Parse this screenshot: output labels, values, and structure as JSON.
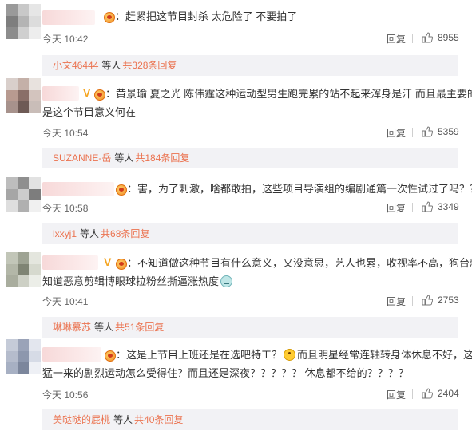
{
  "comments": [
    {
      "lines": [
        "：赶紧把这节目封杀 太危险了 不要拍了"
      ],
      "time": "今天 10:42",
      "reply": "回复",
      "likes": "8955",
      "replies": {
        "who": "小文46444",
        "mid": "等人",
        "count": "共328条回复"
      },
      "avatar_colors": [
        "#9a9a9a",
        "#c8c8c8",
        "#e6e6e6",
        "#7e7e7e",
        "#b4b4b4",
        "#dcdcdc",
        "#8c8c8c",
        "#cfcfcf",
        "#ededed"
      ]
    },
    {
      "lines": [
        "：黄景瑜 夏之光 陈伟霆这种运动型男生跑完累的站不起来浑身是汗 而且最主要的",
        "是这个节目意义何在"
      ],
      "time": "今天 10:54",
      "reply": "回复",
      "likes": "5359",
      "replies": {
        "who": "SUZANNE-岳",
        "mid": "等人",
        "count": "共184条回复"
      },
      "avatar_colors": [
        "#d9cfcb",
        "#c4b0a8",
        "#e8e2de",
        "#b89a90",
        "#8a6f68",
        "#d3c4be",
        "#a7928c",
        "#6e5a55",
        "#c9bdb8"
      ]
    },
    {
      "lines": [
        "：害，为了刺激，啥都敢拍，这些项目导演组的编剧通篇一次性试过了吗？？"
      ],
      "time": "今天 10:58",
      "reply": "回复",
      "likes": "3349",
      "replies": {
        "who": "lxxyj1",
        "mid": "等人",
        "count": "共68条回复"
      },
      "avatar_colors": [
        "#bdbdbd",
        "#8f8f8f",
        "#e2e2e2",
        "#a6a6a6",
        "#cccccc",
        "#7d7d7d",
        "#dedede",
        "#b0b0b0",
        "#f0f0f0"
      ]
    },
    {
      "lines": [
        "：不知道做这种节目有什么意义，又没意思，艺人也累，收视率不高，狗台就",
        "知道恶意剪辑博眼球拉粉丝撕逼涨热度"
      ],
      "time": "今天 10:41",
      "reply": "回复",
      "likes": "2753",
      "replies": {
        "who": "琳琳慕苏",
        "mid": "等人",
        "count": "共51条回复"
      },
      "avatar_colors": [
        "#c2c6b8",
        "#9ea393",
        "#e4e6de",
        "#b3b7a8",
        "#7f8474",
        "#d6d9ce",
        "#a9ad9e",
        "#cdd0c5",
        "#eceee8"
      ]
    },
    {
      "lines": [
        "：这是上节目上班还是在选吧特工？",
        "而且明星经常连轴转身体休息不好，这种",
        "猛一来的剧烈运动怎么受得住？而且还是深夜？？？？？ 休息都不给的？？？？"
      ],
      "time": "今天 10:56",
      "reply": "回复",
      "likes": "2404",
      "replies": {
        "who": "美哒哒的屁桃",
        "mid": "等人",
        "count": "共40条回复"
      },
      "avatar_colors": [
        "#c5cbd8",
        "#9aa3b8",
        "#e3e6ee",
        "#b5bccc",
        "#8d97ad",
        "#d6dbe6",
        "#a7b0c3",
        "#7c869c",
        "#eef0f5"
      ]
    }
  ],
  "colors": {
    "accent": "#eb7350",
    "reply_bg": "#f2f2f5",
    "name_blur": "#f7d9d9",
    "text": "#333333",
    "meta": "#666666"
  },
  "icons": {
    "like": "thumbs-up-icon",
    "vip": "vip-v-icon",
    "badge": "fan-badge-icon"
  }
}
